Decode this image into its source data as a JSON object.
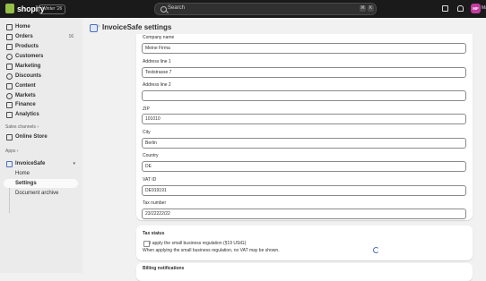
{
  "topbar": {
    "logo_text": "shopify",
    "edition_badge": "Winter '26",
    "search_placeholder": "Search",
    "shortcut_keys": [
      "⌘",
      "K"
    ],
    "avatar_initials": "MF",
    "user_name": "Ma"
  },
  "sidebar": {
    "items": [
      {
        "label": "Home"
      },
      {
        "label": "Orders",
        "badge": "16"
      },
      {
        "label": "Products"
      },
      {
        "label": "Customers"
      },
      {
        "label": "Marketing"
      },
      {
        "label": "Discounts"
      },
      {
        "label": "Content"
      },
      {
        "label": "Markets"
      },
      {
        "label": "Finance"
      },
      {
        "label": "Analytics"
      }
    ],
    "sales_channels_label": "Sales channels",
    "sales_channels": [
      {
        "label": "Online Store"
      }
    ],
    "apps_label": "Apps",
    "app_name": "InvoiceSafe",
    "app_subitems": [
      {
        "label": "Home"
      },
      {
        "label": "Settings"
      },
      {
        "label": "Document archive"
      }
    ]
  },
  "page": {
    "title": "InvoiceSafe settings"
  },
  "form": {
    "company_name": {
      "label": "Company name",
      "value": "Meine Firma"
    },
    "address1": {
      "label": "Address line 1",
      "value": "Teststrasse 7"
    },
    "address2": {
      "label": "Address line 2",
      "value": ""
    },
    "zip": {
      "label": "ZIP",
      "value": "101010"
    },
    "city": {
      "label": "City",
      "value": "Berlin"
    },
    "country": {
      "label": "Country",
      "value": "DE"
    },
    "vat_id": {
      "label": "VAT ID",
      "value": "DE919191"
    },
    "tax_number": {
      "label": "Tax number",
      "value": "23/22222/22"
    }
  },
  "tax_status": {
    "title": "Tax status",
    "checkbox_label": "I apply the small business regulation (§19 UStG)",
    "help_text": "When applying the small business regulation, no VAT may be shown."
  },
  "billing": {
    "title": "Billing notifications"
  }
}
